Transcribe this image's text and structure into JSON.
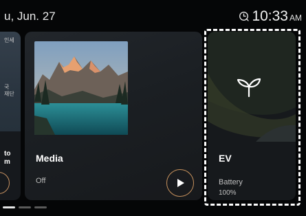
{
  "status_bar": {
    "date": "u, Jun. 27",
    "time": "10:33",
    "ampm": "AM",
    "icon": "connected-clock-icon"
  },
  "cards": {
    "left_partial": {
      "line1": "인세",
      "line2": "국",
      "line3": "재단",
      "line4": "to",
      "line5": "m"
    },
    "media": {
      "title": "Media",
      "status": "Off",
      "play_icon": "play-icon"
    },
    "ev": {
      "title": "EV",
      "label": "Battery",
      "value": "100%",
      "icon": "leaf-sprout-icon"
    }
  },
  "pager": {
    "count": 3,
    "active": 0
  },
  "colors": {
    "accent": "#c8925d",
    "focus": "#ffffff",
    "card_bg": "#1b1f23",
    "page_bg": "#050607"
  }
}
